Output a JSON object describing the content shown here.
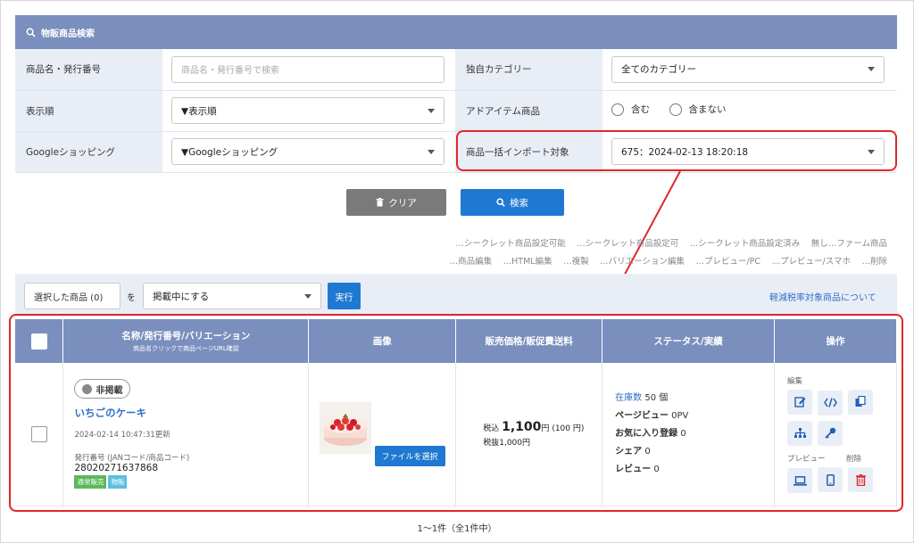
{
  "search_panel": {
    "title": "物販商品検索",
    "rows": {
      "name_label": "商品名・発行番号",
      "name_placeholder": "商品名・発行番号で検索",
      "category_label": "独自カテゴリー",
      "category_value": "全てのカテゴリー",
      "order_label": "表示順",
      "order_value": "▼表示順",
      "add_item_label": "アドアイテム商品",
      "add_item_yes": "含む",
      "add_item_no": "含まない",
      "google_label": "Googleショッピング",
      "google_value": "▼Googleショッピング",
      "import_label": "商品一括インポート対象",
      "import_value": "675：2024-02-13 18:20:18"
    },
    "clear_button": "クリア",
    "search_button": "検索"
  },
  "legend": {
    "line1": "…シークレット商品設定可能 　…シークレット商品設定可 　…シークレット商品設定済み 　無し…ファーム商品",
    "line2": "…商品編集 　…HTML編集 　…複製 　…バリエーション編集 　…プレビュー/PC 　…プレビュー/スマホ 　…削除"
  },
  "bulk": {
    "selected": "選択した商品 (0)",
    "wo": "を",
    "action": "掲載中にする",
    "run": "実行",
    "tax_link": "軽減税率対象商品について"
  },
  "table": {
    "headers": {
      "name": "名称/発行番号/バリエーション",
      "name_sub": "商品名クリックで商品ページURL確認",
      "image": "画像",
      "price": "販売価格/販促費送料",
      "status": "ステータス/実績",
      "ops": "操作"
    },
    "row": {
      "status_pill": "非掲載",
      "name": "いちごのケーキ",
      "updated": "2024-02-14 10:47:31更新",
      "code_label": "発行番号 (JANコード/商品コード)",
      "code": "28020271637868",
      "badge1": "通常販売",
      "badge2": "物販",
      "file_button": "ファイルを選択",
      "price_prefix": "税込",
      "price_main": "1,100",
      "price_unit": "円",
      "price_shipping": "(100 円)",
      "price_ex": "税抜1,000円",
      "stock_label": "在庫数",
      "stock_value": "50 個",
      "pv_label": "ページビュー",
      "pv_value": "0PV",
      "fav_label": "お気に入り登録",
      "fav_value": "0",
      "share_label": "シェア",
      "share_value": "0",
      "review_label": "レビュー",
      "review_value": "0",
      "edit_label": "編集",
      "preview_label": "プレビュー",
      "delete_label": "削除"
    }
  },
  "footer": {
    "count": "1〜1件（全1件中）"
  },
  "colors": {
    "header_bg": "#7a8fbd",
    "label_bg": "#e9eef6",
    "primary": "#1f78d1",
    "highlight": "#e0262a"
  }
}
